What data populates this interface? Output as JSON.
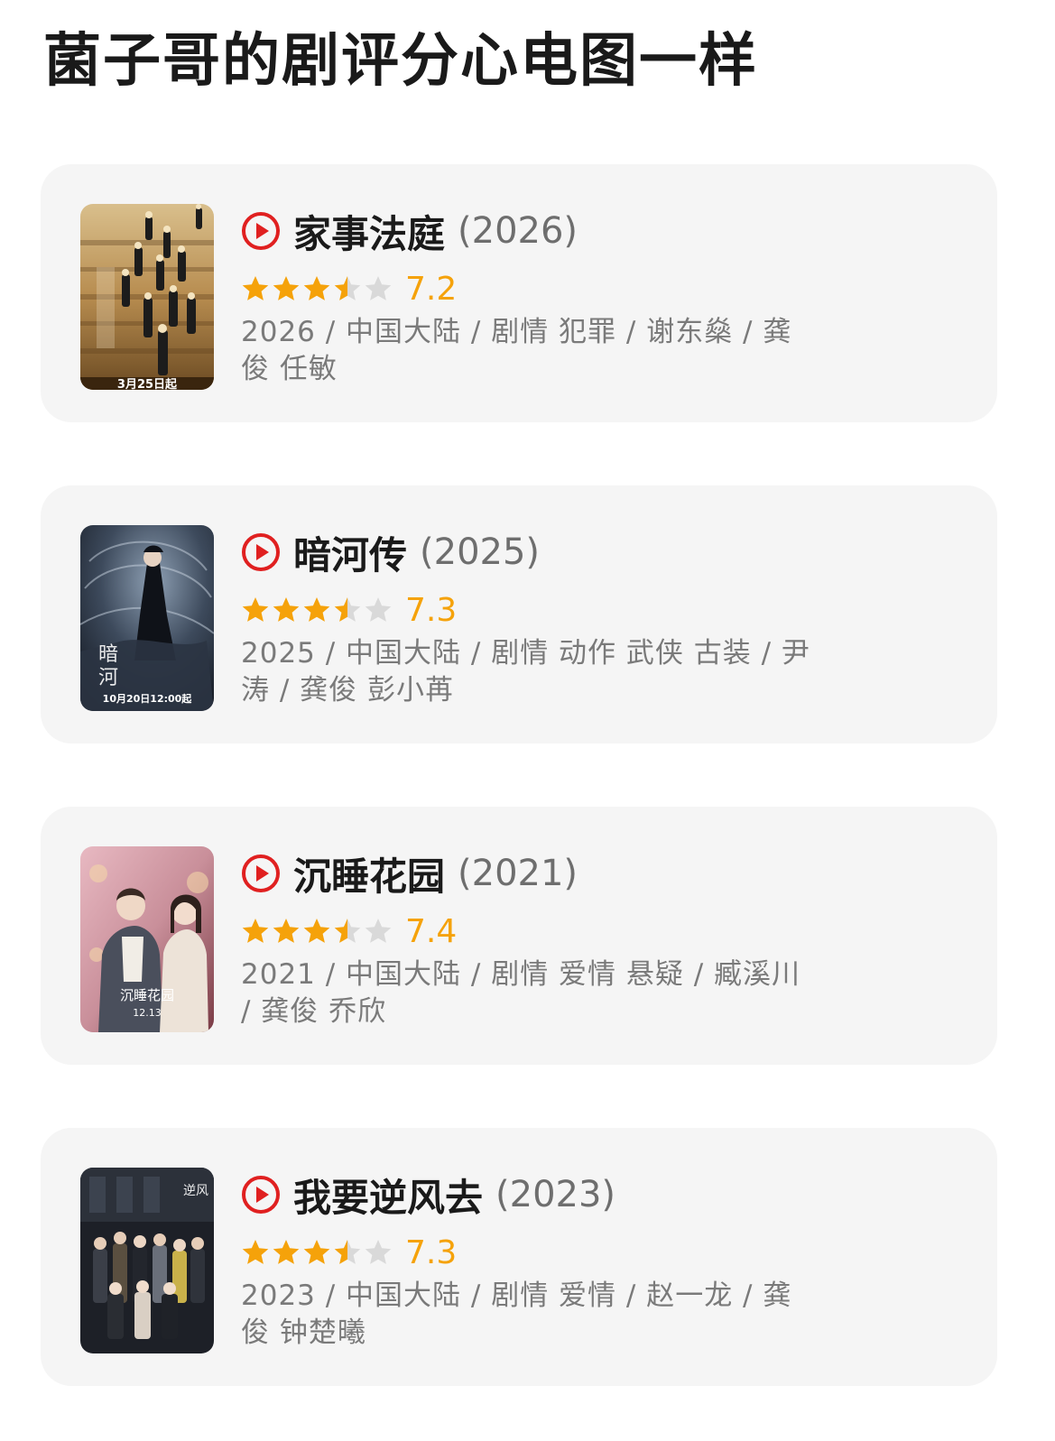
{
  "page": {
    "title": "菌子哥的剧评分心电图一样"
  },
  "colors": {
    "accent_star": "#f5a20a",
    "star_empty": "#d9d9d9",
    "play_icon": "#e02020",
    "card_bg": "#f5f5f5"
  },
  "cards": [
    {
      "title": "家事法庭",
      "year": "(2026)",
      "rating": 7.2,
      "rating_text": "7.2",
      "stars": 3.5,
      "meta": "2026 / 中国大陆 / 剧情 犯罪 / 谢东燊 / 龚俊 任敏",
      "poster_text": "3月25日起",
      "poster_icon": "poster-family-court"
    },
    {
      "title": "暗河传",
      "year": "(2025)",
      "rating": 7.3,
      "rating_text": "7.3",
      "stars": 3.5,
      "meta": "2025 / 中国大陆 / 剧情 动作 武侠 古装 / 尹涛 / 龚俊 彭小苒",
      "poster_text": "10月20日12:00起",
      "poster_icon": "poster-dark-river"
    },
    {
      "title": "沉睡花园",
      "year": "(2021)",
      "rating": 7.4,
      "rating_text": "7.4",
      "stars": 3.5,
      "meta": "2021 / 中国大陆 / 剧情 爱情 悬疑 / 臧溪川 / 龚俊 乔欣",
      "poster_text": "12.13",
      "poster_icon": "poster-sleeping-garden"
    },
    {
      "title": "我要逆风去",
      "year": "(2023)",
      "rating": 7.3,
      "rating_text": "7.3",
      "stars": 3.5,
      "meta": "2023 / 中国大陆 / 剧情 爱情 / 赵一龙 / 龚俊 钟楚曦",
      "poster_text": "",
      "poster_icon": "poster-against-wind"
    }
  ]
}
